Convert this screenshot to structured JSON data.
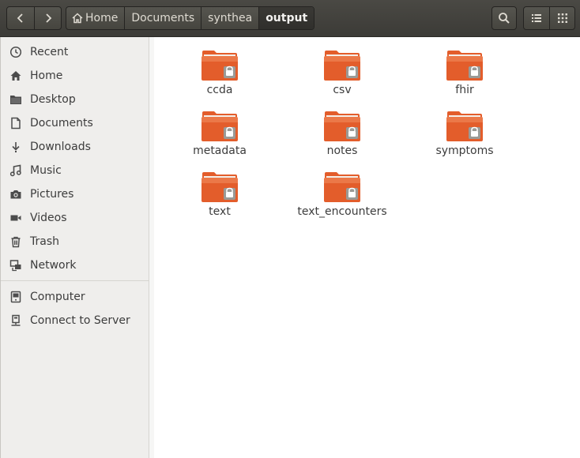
{
  "header": {
    "breadcrumbs": [
      {
        "label": "Home",
        "icon": "home-icon"
      },
      {
        "label": "Documents"
      },
      {
        "label": "synthea"
      },
      {
        "label": "output",
        "active": true
      }
    ]
  },
  "sidebar": {
    "places": [
      {
        "label": "Recent",
        "icon": "clock-icon"
      },
      {
        "label": "Home",
        "icon": "home-icon"
      },
      {
        "label": "Desktop",
        "icon": "folder-icon"
      },
      {
        "label": "Documents",
        "icon": "document-icon"
      },
      {
        "label": "Downloads",
        "icon": "download-icon"
      },
      {
        "label": "Music",
        "icon": "music-icon"
      },
      {
        "label": "Pictures",
        "icon": "camera-icon"
      },
      {
        "label": "Videos",
        "icon": "video-icon"
      },
      {
        "label": "Trash",
        "icon": "trash-icon"
      },
      {
        "label": "Network",
        "icon": "network-icon"
      }
    ],
    "devices": [
      {
        "label": "Computer",
        "icon": "computer-icon"
      },
      {
        "label": "Connect to Server",
        "icon": "server-icon"
      }
    ]
  },
  "files": [
    {
      "name": "ccda"
    },
    {
      "name": "csv"
    },
    {
      "name": "fhir"
    },
    {
      "name": "metadata"
    },
    {
      "name": "notes"
    },
    {
      "name": "symptoms"
    },
    {
      "name": "text"
    },
    {
      "name": "text_encounters"
    }
  ],
  "colors": {
    "folder_orange": "#e35d2b",
    "folder_light": "#f08a5b",
    "header_bg": "#3c3b37",
    "sidebar_bg": "#efeeec"
  }
}
